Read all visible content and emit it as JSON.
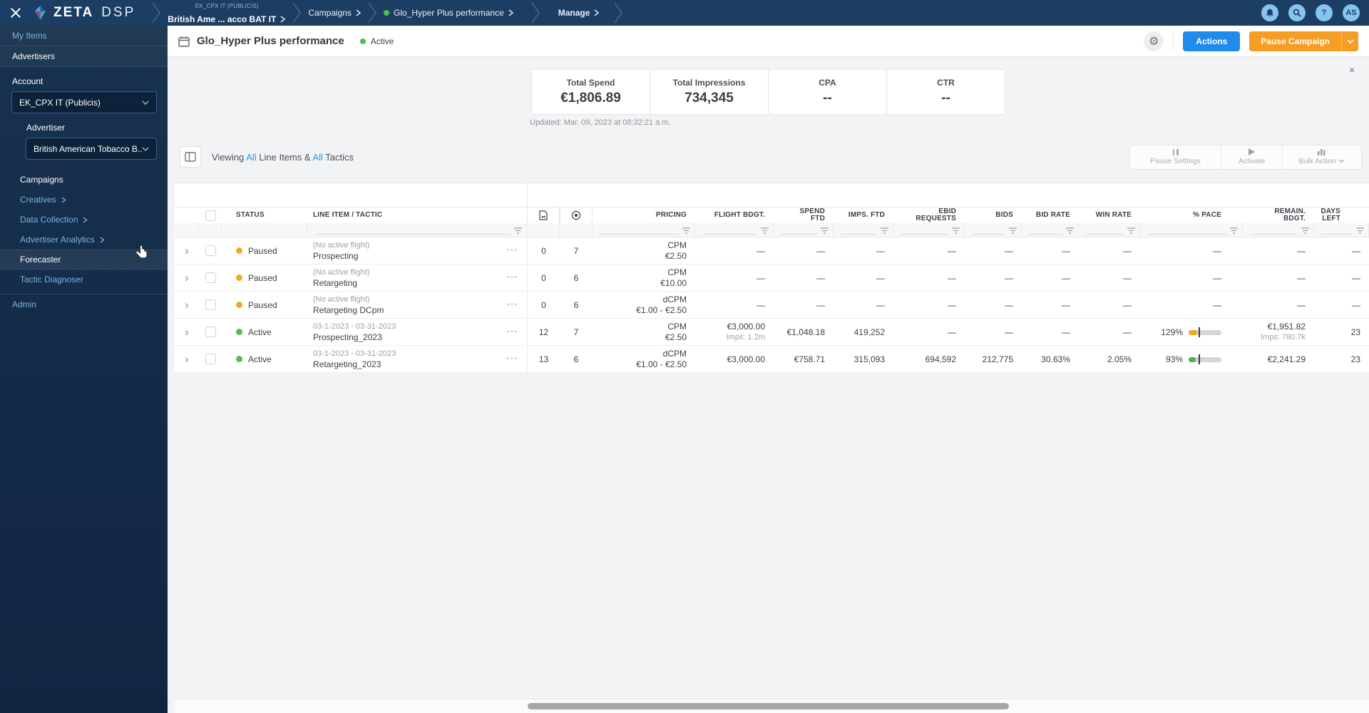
{
  "icons": {
    "ellipsis": "•••",
    "chevron_right": "›",
    "gear": "⚙",
    "help": "?",
    "close_small": "×"
  },
  "topbar": {
    "logo_zeta": "ZETA",
    "logo_dsp": "DSP",
    "crumb1_top": "EK_CPX IT (PUBLICIS)",
    "crumb1": "British Ame ... acco BAT IT",
    "crumb2": "Campaigns",
    "crumb3": "Glo_Hyper Plus performance",
    "crumb4": "Manage",
    "avatar_initials": "AS"
  },
  "sidebar": {
    "my_items": "My Items",
    "advertisers": "Advertisers",
    "account_label": "Account",
    "account_value": "EK_CPX IT (Publicis)",
    "advertiser_label": "Advertiser",
    "advertiser_value": "British American Tobacco B...",
    "campaigns": "Campaigns",
    "creatives": "Creatives",
    "data_collection": "Data Collection",
    "advertiser_analytics": "Advertiser Analytics",
    "forecaster": "Forecaster",
    "tactic_diagnoser": "Tactic Diagnoser",
    "admin": "Admin"
  },
  "header": {
    "title": "Glo_Hyper Plus performance",
    "status": "Active",
    "status_color": "#4bc14b",
    "actions_label": "Actions",
    "pause_campaign_label": "Pause Campaign"
  },
  "stats": {
    "items": [
      {
        "label": "Total Spend",
        "value": "€1,806.89"
      },
      {
        "label": "Total Impressions",
        "value": "734,345"
      },
      {
        "label": "CPA",
        "value": "--"
      },
      {
        "label": "CTR",
        "value": "--"
      }
    ],
    "updated": "Updated: Mar. 09, 2023 at 08:32:21 a.m."
  },
  "toolbar": {
    "viewing_prefix": "Viewing",
    "all_link_1": "All",
    "viewing_mid": "Line Items &",
    "all_link_2": "All",
    "viewing_suffix": "Tactics",
    "pause_settings_label": "Pause Settings",
    "activate_label": "Activate",
    "bulk_action_label": "Bulk Action"
  },
  "table": {
    "headers": {
      "status": "STATUS",
      "line_item": "LINE ITEM / TACTIC",
      "pricing": "PRICING",
      "flight_bdgt": "FLIGHT BDGT.",
      "spend_ftd": "SPEND\nFTD",
      "imps_ftd": "IMPS. FTD",
      "ebid_requests": "EBID\nREQUESTS",
      "bids": "BIDS",
      "bid_rate": "BID RATE",
      "win_rate": "WIN RATE",
      "pace": "% PACE",
      "remain_bdgt": "REMAIN.\nBDGT.",
      "days_left": "DAYS\nLEFT"
    },
    "rows": [
      {
        "status": "Paused",
        "dot": "#f5a623",
        "flight": "(No active flight)",
        "name": "Prospecting",
        "creatives": "0",
        "tactics": "7",
        "pricing_type": "CPM",
        "pricing_value": "€2.50",
        "flight_bdgt": "—",
        "spend": "—",
        "imps": "—",
        "ebid": "—",
        "bids": "—",
        "bid_rate": "—",
        "win_rate": "—",
        "pace": "—",
        "remain": "—",
        "days": "—"
      },
      {
        "status": "Paused",
        "dot": "#f5a623",
        "flight": "(No active flight)",
        "name": "Retargeting",
        "creatives": "0",
        "tactics": "6",
        "pricing_type": "CPM",
        "pricing_value": "€10.00",
        "flight_bdgt": "—",
        "spend": "—",
        "imps": "—",
        "ebid": "—",
        "bids": "—",
        "bid_rate": "—",
        "win_rate": "—",
        "pace": "—",
        "remain": "—",
        "days": "—"
      },
      {
        "status": "Paused",
        "dot": "#f5a623",
        "flight": "(No active flight)",
        "name": "Retargeting DCpm",
        "creatives": "0",
        "tactics": "6",
        "pricing_type": "dCPM",
        "pricing_value": "€1.00 - €2.50",
        "flight_bdgt": "—",
        "spend": "—",
        "imps": "—",
        "ebid": "—",
        "bids": "—",
        "bid_rate": "—",
        "win_rate": "—",
        "pace": "—",
        "remain": "—",
        "days": "—"
      },
      {
        "status": "Active",
        "dot": "#4bc14b",
        "flight": "03-1-2023 - 03-31-2023",
        "name": "Prospecting_2023",
        "creatives": "12",
        "tactics": "7",
        "pricing_type": "CPM",
        "pricing_value": "€2.50",
        "flight_bdgt": "€3,000.00",
        "flight_sub": "Imps: 1.2m",
        "spend": "€1,048.18",
        "imps": "419,252",
        "ebid": "—",
        "bids": "—",
        "bid_rate": "—",
        "win_rate": "—",
        "pace_pct": "129%",
        "pace_color": "#f5a623",
        "pace_fill": "26%",
        "pace_marker": "31%",
        "remain": "€1,951.82",
        "remain_sub": "Imps: 780.7k",
        "days": "23"
      },
      {
        "status": "Active",
        "dot": "#4bc14b",
        "flight": "03-1-2023 - 03-31-2023",
        "name": "Retargeting_2023",
        "creatives": "13",
        "tactics": "6",
        "pricing_type": "dCPM",
        "pricing_value": "€1.00 - €2.50",
        "flight_bdgt": "€3,000.00",
        "flight_sub": "",
        "spend": "€758.71",
        "imps": "315,093",
        "ebid": "694,592",
        "bids": "212,775",
        "bid_rate": "30.63%",
        "win_rate": "2.05%",
        "pace_pct": "93%",
        "pace_color": "#4caf50",
        "pace_fill": "22%",
        "pace_marker": "31%",
        "remain": "€2,241.29",
        "remain_sub": "",
        "days": "23"
      }
    ]
  }
}
